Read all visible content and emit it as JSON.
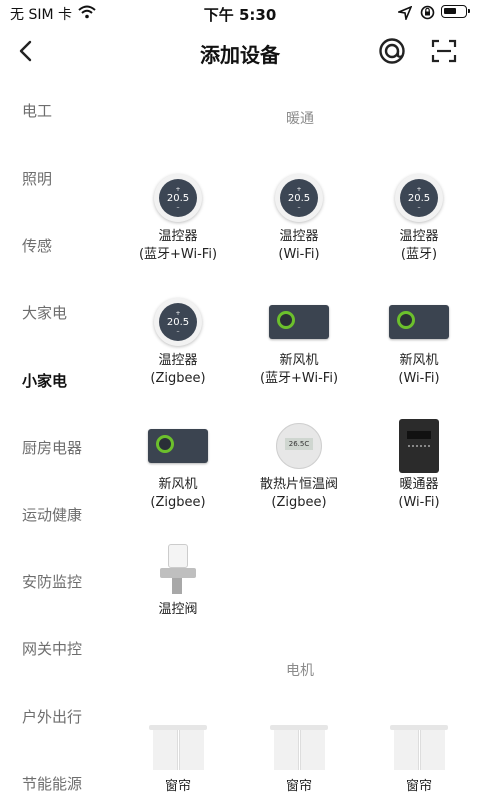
{
  "status_bar": {
    "carrier": "无 SIM 卡",
    "time": "下午 5:30"
  },
  "navbar": {
    "title": "添加设备"
  },
  "categories": [
    {
      "label": "电工",
      "active": false
    },
    {
      "label": "照明",
      "active": false
    },
    {
      "label": "传感",
      "active": false
    },
    {
      "label": "大家电",
      "active": false
    },
    {
      "label": "小家电",
      "active": true
    },
    {
      "label": "厨房电器",
      "active": false
    },
    {
      "label": "运动健康",
      "active": false
    },
    {
      "label": "安防监控",
      "active": false
    },
    {
      "label": "网关中控",
      "active": false
    },
    {
      "label": "户外出行",
      "active": false
    },
    {
      "label": "节能能源",
      "active": false
    }
  ],
  "sections": {
    "hvac": {
      "title": "暖通",
      "devices": [
        {
          "name": "温控器",
          "sub": "(蓝牙+Wi-Fi)",
          "icon": "thermostat-icon",
          "display": "20.5"
        },
        {
          "name": "温控器",
          "sub": "(Wi-Fi)",
          "icon": "thermostat-icon",
          "display": "20.5"
        },
        {
          "name": "温控器",
          "sub": "(蓝牙)",
          "icon": "thermostat-icon",
          "display": "20.5"
        },
        {
          "name": "温控器",
          "sub": "(Zigbee)",
          "icon": "thermostat-icon",
          "display": "20.5"
        },
        {
          "name": "新风机",
          "sub": "(蓝牙+Wi-Fi)",
          "icon": "ventilator-panel-icon"
        },
        {
          "name": "新风机",
          "sub": "(Wi-Fi)",
          "icon": "ventilator-panel-icon"
        },
        {
          "name": "新风机",
          "sub": "(Zigbee)",
          "icon": "ventilator-panel-icon"
        },
        {
          "name": "散热片恒温阀",
          "sub": "(Zigbee)",
          "icon": "radiator-valve-icon",
          "display": "26.5C"
        },
        {
          "name": "暖通器",
          "sub": "(Wi-Fi)",
          "icon": "heater-icon"
        },
        {
          "name": "温控阀",
          "sub": "",
          "icon": "thermostatic-valve-icon"
        }
      ]
    },
    "motor": {
      "title": "电机",
      "devices": [
        {
          "name": "窗帘",
          "icon": "curtain-icon"
        },
        {
          "name": "窗帘",
          "icon": "curtain-icon"
        },
        {
          "name": "窗帘",
          "icon": "curtain-icon"
        }
      ]
    }
  },
  "colors": {
    "accent_green": "#6cc02c",
    "panel": "#3b4450",
    "text_muted": "#6e6e6e"
  }
}
